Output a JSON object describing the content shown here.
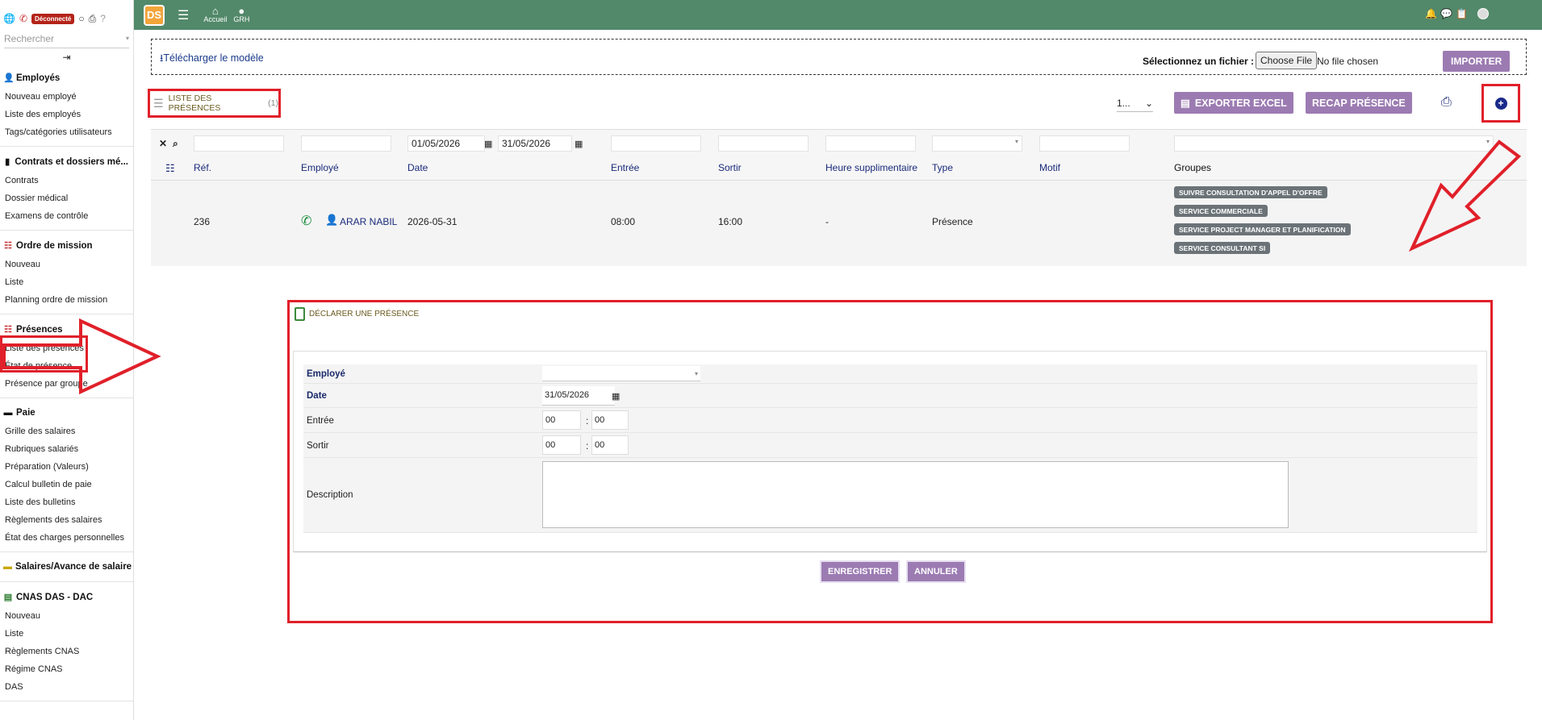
{
  "sidebar": {
    "status_badge": "Déconnecté",
    "search_placeholder": "Rechercher",
    "sections": [
      {
        "title": "Employés",
        "icon": "user-icon",
        "items": [
          "Nouveau employé",
          "Liste des employés",
          "Tags/catégories utilisateurs"
        ]
      },
      {
        "title": "Contrats et dossiers mé...",
        "icon": "folder-icon",
        "items": [
          "Contrats",
          "Dossier médical",
          "Examens de contrôle"
        ]
      },
      {
        "title": "Ordre de mission",
        "icon": "list-icon",
        "items": [
          "Nouveau",
          "Liste",
          "Planning ordre de mission"
        ]
      },
      {
        "title": "Présences",
        "icon": "list-icon",
        "items": [
          "Liste des présences",
          "État de présence",
          "Présence par groupe"
        ]
      },
      {
        "title": "Paie",
        "icon": "money-icon",
        "items": [
          "Grille des salaires",
          "Rubriques salariés",
          "Préparation (Valeurs)",
          "Calcul bulletin de paie",
          "Liste des bulletins",
          "Règlements des salaires",
          "État des charges personnelles"
        ]
      },
      {
        "title": "Salaires/Avance de salaire",
        "icon": "wallet-icon",
        "items": []
      },
      {
        "title": "CNAS DAS - DAC",
        "icon": "document-icon",
        "items": [
          "Nouveau",
          "Liste",
          "Règlements CNAS",
          "Régime CNAS",
          "DAS"
        ]
      }
    ]
  },
  "topbar": {
    "logo": "DS",
    "nav": [
      {
        "label": "Accueil",
        "icon": "home-icon"
      },
      {
        "label": "GRH",
        "icon": "user-icon"
      }
    ]
  },
  "import": {
    "download_link": "Télécharger le modèle",
    "file_label": "Sélectionnez un fichier :",
    "file_button": "Choose File",
    "file_none": "No file chosen",
    "import_button": "IMPORTER"
  },
  "list": {
    "title": "LISTE DES PRÉSENCES",
    "count": "(1)",
    "per_page": "1...",
    "export_button": "EXPORTER EXCEL",
    "recap_button": "RECAP PRÉSENCE"
  },
  "table": {
    "filter_date_from": "01/05/2026",
    "filter_date_to": "31/05/2026",
    "columns": [
      "Réf.",
      "Employé",
      "Date",
      "Entrée",
      "Sortir",
      "Heure supplimentaire",
      "Type",
      "Motif",
      "Groupes"
    ],
    "rows": [
      {
        "ref": "236",
        "employee": "ARAR NABIL",
        "date": "2026-05-31",
        "entree": "08:00",
        "sortir": "16:00",
        "heure_sup": "-",
        "type": "Présence",
        "motif": "",
        "groupes": [
          "SUIVRE CONSULTATION D'APPEL D'OFFRE",
          "SERVICE COMMERCIALE",
          "SERVICE PROJECT MANAGER ET PLANIFICATION",
          "SERVICE CONSULTANT SI"
        ]
      }
    ]
  },
  "form": {
    "title": "DÉCLARER UNE PRÉSENCE",
    "employe_label": "Employé",
    "date_label": "Date",
    "date_value": "31/05/2026",
    "entree_label": "Entrée",
    "sortir_label": "Sortir",
    "hour_value": "00",
    "minute_value": "00",
    "description_label": "Description",
    "save_button": "ENREGISTRER",
    "cancel_button": "ANNULER"
  },
  "colors": {
    "topbar": "#52896a",
    "accent": "#9c7bb2",
    "highlight": "#e0202a",
    "link": "#1a2a7a"
  }
}
